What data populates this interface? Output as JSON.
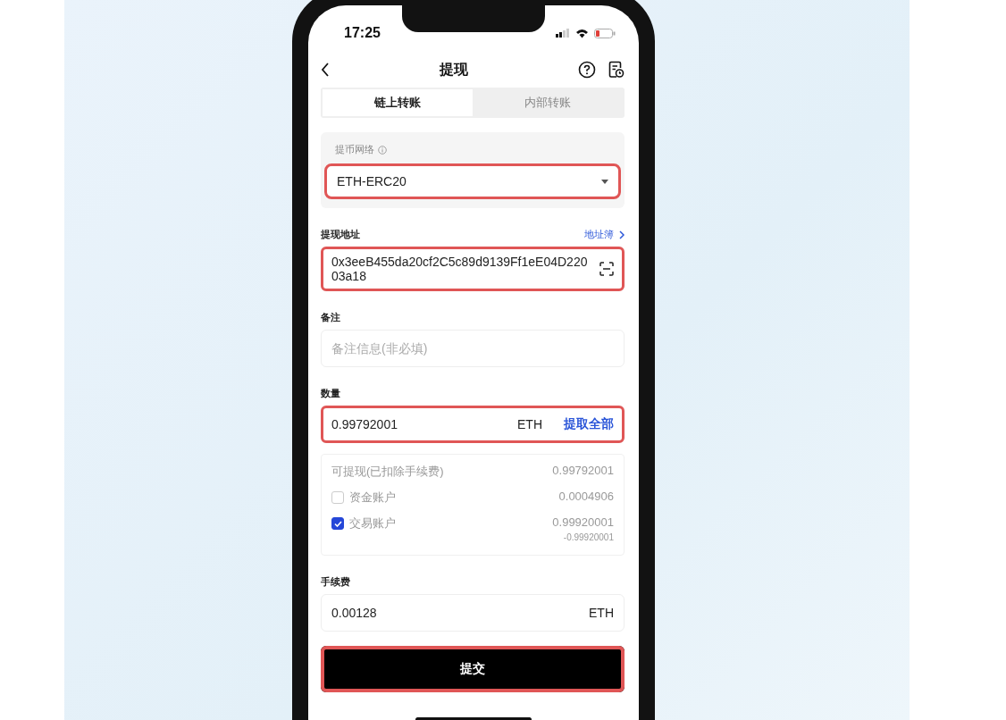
{
  "status_bar": {
    "time": "17:25"
  },
  "header": {
    "title": "提现"
  },
  "tabs": [
    {
      "label": "链上转账",
      "selected": true
    },
    {
      "label": "内部转账",
      "selected": false
    }
  ],
  "network": {
    "label": "提币网络",
    "value": "ETH-ERC20",
    "highlighted": true
  },
  "address": {
    "label": "提现地址",
    "link": "地址簿",
    "value": "0x3eeB455da20cf2C5c89d9139Ff1eE04D22003a18",
    "highlighted": true
  },
  "remark": {
    "label": "备注",
    "placeholder": "备注信息(非必填)"
  },
  "amount": {
    "label": "数量",
    "value": "0.99792001",
    "unit": "ETH",
    "action": "提取全部",
    "highlighted": true
  },
  "breakdown": [
    {
      "kind": "summary",
      "label": "可提现(已扣除手续费)",
      "value": "0.99792001"
    },
    {
      "kind": "account",
      "label": "资金账户",
      "value": "0.0004906",
      "checked": false
    },
    {
      "kind": "account",
      "label": "交易账户",
      "value": "0.99920001",
      "note": "-0.99920001",
      "checked": true
    }
  ],
  "fee": {
    "label": "手续费",
    "value": "0.00128",
    "unit": "ETH"
  },
  "submit": {
    "label": "提交",
    "highlighted": true
  }
}
